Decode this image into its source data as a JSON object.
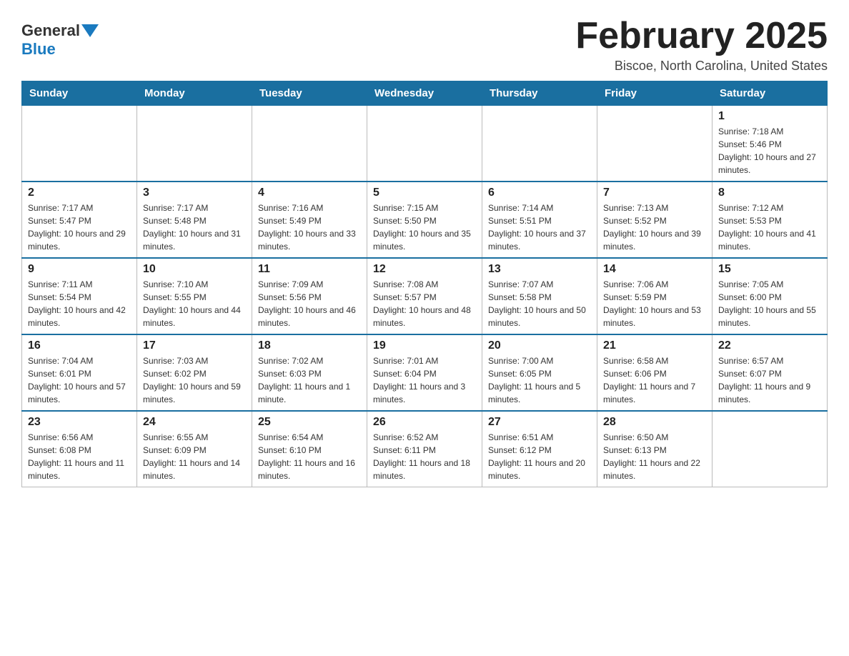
{
  "header": {
    "logo_general": "General",
    "logo_blue": "Blue",
    "month_title": "February 2025",
    "location": "Biscoe, North Carolina, United States"
  },
  "days_of_week": [
    "Sunday",
    "Monday",
    "Tuesday",
    "Wednesday",
    "Thursday",
    "Friday",
    "Saturday"
  ],
  "weeks": [
    [
      {
        "day": "",
        "sunrise": "",
        "sunset": "",
        "daylight": ""
      },
      {
        "day": "",
        "sunrise": "",
        "sunset": "",
        "daylight": ""
      },
      {
        "day": "",
        "sunrise": "",
        "sunset": "",
        "daylight": ""
      },
      {
        "day": "",
        "sunrise": "",
        "sunset": "",
        "daylight": ""
      },
      {
        "day": "",
        "sunrise": "",
        "sunset": "",
        "daylight": ""
      },
      {
        "day": "",
        "sunrise": "",
        "sunset": "",
        "daylight": ""
      },
      {
        "day": "1",
        "sunrise": "Sunrise: 7:18 AM",
        "sunset": "Sunset: 5:46 PM",
        "daylight": "Daylight: 10 hours and 27 minutes."
      }
    ],
    [
      {
        "day": "2",
        "sunrise": "Sunrise: 7:17 AM",
        "sunset": "Sunset: 5:47 PM",
        "daylight": "Daylight: 10 hours and 29 minutes."
      },
      {
        "day": "3",
        "sunrise": "Sunrise: 7:17 AM",
        "sunset": "Sunset: 5:48 PM",
        "daylight": "Daylight: 10 hours and 31 minutes."
      },
      {
        "day": "4",
        "sunrise": "Sunrise: 7:16 AM",
        "sunset": "Sunset: 5:49 PM",
        "daylight": "Daylight: 10 hours and 33 minutes."
      },
      {
        "day": "5",
        "sunrise": "Sunrise: 7:15 AM",
        "sunset": "Sunset: 5:50 PM",
        "daylight": "Daylight: 10 hours and 35 minutes."
      },
      {
        "day": "6",
        "sunrise": "Sunrise: 7:14 AM",
        "sunset": "Sunset: 5:51 PM",
        "daylight": "Daylight: 10 hours and 37 minutes."
      },
      {
        "day": "7",
        "sunrise": "Sunrise: 7:13 AM",
        "sunset": "Sunset: 5:52 PM",
        "daylight": "Daylight: 10 hours and 39 minutes."
      },
      {
        "day": "8",
        "sunrise": "Sunrise: 7:12 AM",
        "sunset": "Sunset: 5:53 PM",
        "daylight": "Daylight: 10 hours and 41 minutes."
      }
    ],
    [
      {
        "day": "9",
        "sunrise": "Sunrise: 7:11 AM",
        "sunset": "Sunset: 5:54 PM",
        "daylight": "Daylight: 10 hours and 42 minutes."
      },
      {
        "day": "10",
        "sunrise": "Sunrise: 7:10 AM",
        "sunset": "Sunset: 5:55 PM",
        "daylight": "Daylight: 10 hours and 44 minutes."
      },
      {
        "day": "11",
        "sunrise": "Sunrise: 7:09 AM",
        "sunset": "Sunset: 5:56 PM",
        "daylight": "Daylight: 10 hours and 46 minutes."
      },
      {
        "day": "12",
        "sunrise": "Sunrise: 7:08 AM",
        "sunset": "Sunset: 5:57 PM",
        "daylight": "Daylight: 10 hours and 48 minutes."
      },
      {
        "day": "13",
        "sunrise": "Sunrise: 7:07 AM",
        "sunset": "Sunset: 5:58 PM",
        "daylight": "Daylight: 10 hours and 50 minutes."
      },
      {
        "day": "14",
        "sunrise": "Sunrise: 7:06 AM",
        "sunset": "Sunset: 5:59 PM",
        "daylight": "Daylight: 10 hours and 53 minutes."
      },
      {
        "day": "15",
        "sunrise": "Sunrise: 7:05 AM",
        "sunset": "Sunset: 6:00 PM",
        "daylight": "Daylight: 10 hours and 55 minutes."
      }
    ],
    [
      {
        "day": "16",
        "sunrise": "Sunrise: 7:04 AM",
        "sunset": "Sunset: 6:01 PM",
        "daylight": "Daylight: 10 hours and 57 minutes."
      },
      {
        "day": "17",
        "sunrise": "Sunrise: 7:03 AM",
        "sunset": "Sunset: 6:02 PM",
        "daylight": "Daylight: 10 hours and 59 minutes."
      },
      {
        "day": "18",
        "sunrise": "Sunrise: 7:02 AM",
        "sunset": "Sunset: 6:03 PM",
        "daylight": "Daylight: 11 hours and 1 minute."
      },
      {
        "day": "19",
        "sunrise": "Sunrise: 7:01 AM",
        "sunset": "Sunset: 6:04 PM",
        "daylight": "Daylight: 11 hours and 3 minutes."
      },
      {
        "day": "20",
        "sunrise": "Sunrise: 7:00 AM",
        "sunset": "Sunset: 6:05 PM",
        "daylight": "Daylight: 11 hours and 5 minutes."
      },
      {
        "day": "21",
        "sunrise": "Sunrise: 6:58 AM",
        "sunset": "Sunset: 6:06 PM",
        "daylight": "Daylight: 11 hours and 7 minutes."
      },
      {
        "day": "22",
        "sunrise": "Sunrise: 6:57 AM",
        "sunset": "Sunset: 6:07 PM",
        "daylight": "Daylight: 11 hours and 9 minutes."
      }
    ],
    [
      {
        "day": "23",
        "sunrise": "Sunrise: 6:56 AM",
        "sunset": "Sunset: 6:08 PM",
        "daylight": "Daylight: 11 hours and 11 minutes."
      },
      {
        "day": "24",
        "sunrise": "Sunrise: 6:55 AM",
        "sunset": "Sunset: 6:09 PM",
        "daylight": "Daylight: 11 hours and 14 minutes."
      },
      {
        "day": "25",
        "sunrise": "Sunrise: 6:54 AM",
        "sunset": "Sunset: 6:10 PM",
        "daylight": "Daylight: 11 hours and 16 minutes."
      },
      {
        "day": "26",
        "sunrise": "Sunrise: 6:52 AM",
        "sunset": "Sunset: 6:11 PM",
        "daylight": "Daylight: 11 hours and 18 minutes."
      },
      {
        "day": "27",
        "sunrise": "Sunrise: 6:51 AM",
        "sunset": "Sunset: 6:12 PM",
        "daylight": "Daylight: 11 hours and 20 minutes."
      },
      {
        "day": "28",
        "sunrise": "Sunrise: 6:50 AM",
        "sunset": "Sunset: 6:13 PM",
        "daylight": "Daylight: 11 hours and 22 minutes."
      },
      {
        "day": "",
        "sunrise": "",
        "sunset": "",
        "daylight": ""
      }
    ]
  ]
}
